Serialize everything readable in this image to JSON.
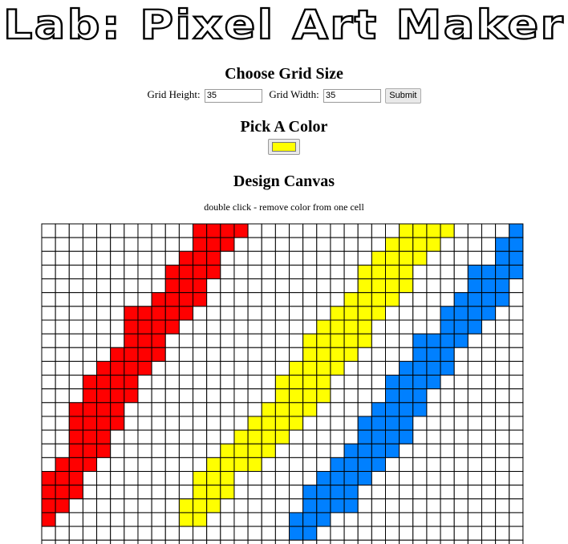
{
  "app": {
    "logo_text": "Lab: Pixel Art Maker"
  },
  "grid_size": {
    "heading": "Choose Grid Size",
    "height_label": "Grid Height:",
    "height_value": "35",
    "width_label": "Grid Width:",
    "width_value": "35",
    "submit_label": "Submit"
  },
  "color": {
    "heading": "Pick A Color",
    "value": "#ffff00"
  },
  "canvas": {
    "heading": "Design Canvas",
    "hint": "double click - remove color from one cell",
    "visible_columns": 35,
    "visible_rows": 24,
    "palette": {
      "R": "#ff0000",
      "Y": "#ffff00",
      "B": "#0080ff"
    },
    "painted_rows": [
      "...........RRRR...........YYYY....B",
      "...........RRR...........YYYY....BB",
      "..........RRR...........YYYY.....BB",
      ".........RRRR..........YYYY....BBBB",
      ".........RRR...........YYYY....BBB.",
      "........RRRR..........YYYY....BBBB.",
      "......RRRRR..........YYYY....BBBB..",
      "......RRRR..........YYYY.....BBB...",
      "......RRR..........YYYYY...BBBB....",
      ".....RRRR..........YYYY....BBB.....",
      "....RRRR..........YYYY....BBBB.....",
      "...RRRR..........YYYY....BBBB......",
      "...RRRR..........YYYY....BBB.......",
      "..RRRR..........YYYY....BBBB.......",
      "..RRRR.........YYYY....BBBB........",
      "..RRR.........YYYY.....BBBB........",
      "..RRR........YYYY.....BBBB.........",
      ".RRR........YYYY.....BBBB..........",
      "RRR........YYY......BBBB...........",
      "RRR........YYY.....BBBB............",
      "RR........YYY......BBBB............",
      "R.........YY......BBB..............",
      "..................BB...............",
      "..................................."
    ]
  }
}
